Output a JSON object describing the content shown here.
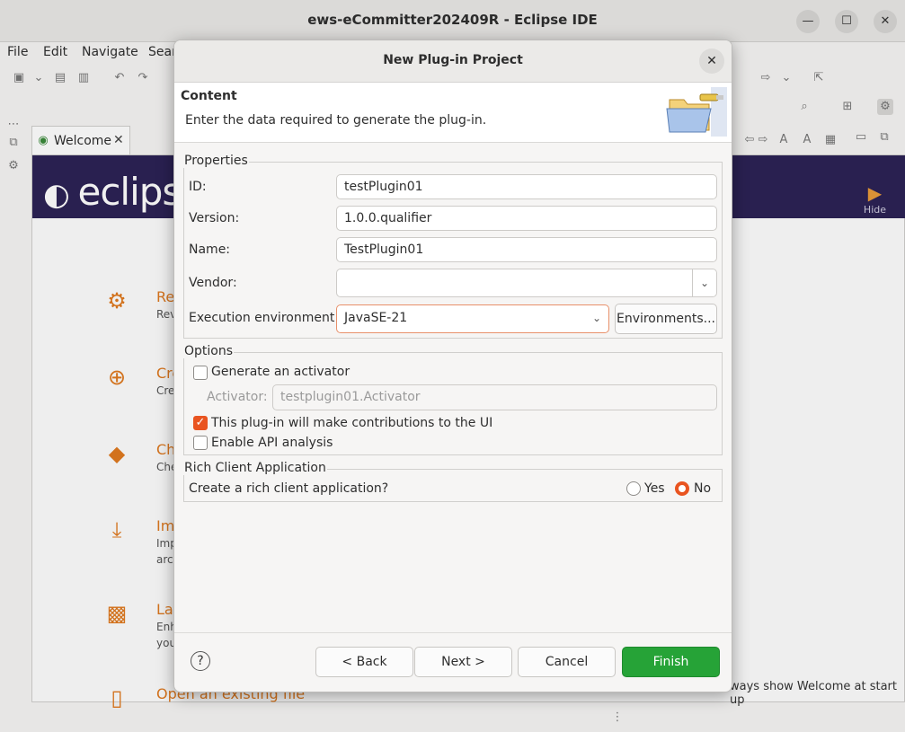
{
  "window": {
    "title": "ews-eCommitter202409R - Eclipse IDE",
    "controls": {
      "minimize": "—",
      "maximize": "☐",
      "close": "✕"
    }
  },
  "menubar": {
    "items": [
      "File",
      "Edit",
      "Navigate",
      "Sear"
    ]
  },
  "welcome": {
    "tab_label": "Welcome",
    "logo_text": "eclips",
    "hide_label": "Hide",
    "items": [
      {
        "icon": "gear-icon",
        "title": "Re",
        "desc": "Rev"
      },
      {
        "icon": "plus-circle-icon",
        "title": "Cre",
        "desc": "Cre"
      },
      {
        "icon": "git-icon",
        "title": "Ch",
        "desc": "Che"
      },
      {
        "icon": "download-icon",
        "title": "Imp",
        "desc": "Imp",
        "desc2": "arch"
      },
      {
        "icon": "package-icon",
        "title": "La",
        "desc": "Enh",
        "desc2": "you"
      },
      {
        "icon": "file-icon",
        "title": "Open an existing file",
        "desc": ""
      }
    ],
    "always_show": "ways show Welcome at start up"
  },
  "dialog": {
    "title": "New Plug-in Project",
    "header": {
      "title": "Content",
      "description": "Enter the data required to generate the plug-in."
    },
    "properties": {
      "group_title": "Properties",
      "id_label": "ID:",
      "id_value": "testPlugin01",
      "version_label": "Version:",
      "version_value": "1.0.0.qualifier",
      "name_label": "Name:",
      "name_value": "TestPlugin01",
      "vendor_label": "Vendor:",
      "vendor_value": "",
      "exec_env_label": "Execution environment:",
      "exec_env_value": "JavaSE-21",
      "environments_button": "Environments..."
    },
    "options": {
      "group_title": "Options",
      "generate_activator_label": "Generate an activator",
      "generate_activator_checked": false,
      "activator_label": "Activator:",
      "activator_value": "testplugin01.Activator",
      "ui_contrib_label": "This plug-in will make contributions to the UI",
      "ui_contrib_checked": true,
      "api_analysis_label": "Enable API analysis",
      "api_analysis_checked": false
    },
    "rca": {
      "group_title": "Rich Client Application",
      "question": "Create a rich client application?",
      "yes_label": "Yes",
      "no_label": "No",
      "selected": "No"
    },
    "buttons": {
      "help": "?",
      "back": "< Back",
      "next": "Next >",
      "cancel": "Cancel",
      "finish": "Finish"
    },
    "close_glyph": "✕"
  },
  "colors": {
    "accent": "#e95420",
    "finish": "#26a337",
    "welcome_orange": "#e07a1f",
    "banner": "#2c2255"
  }
}
